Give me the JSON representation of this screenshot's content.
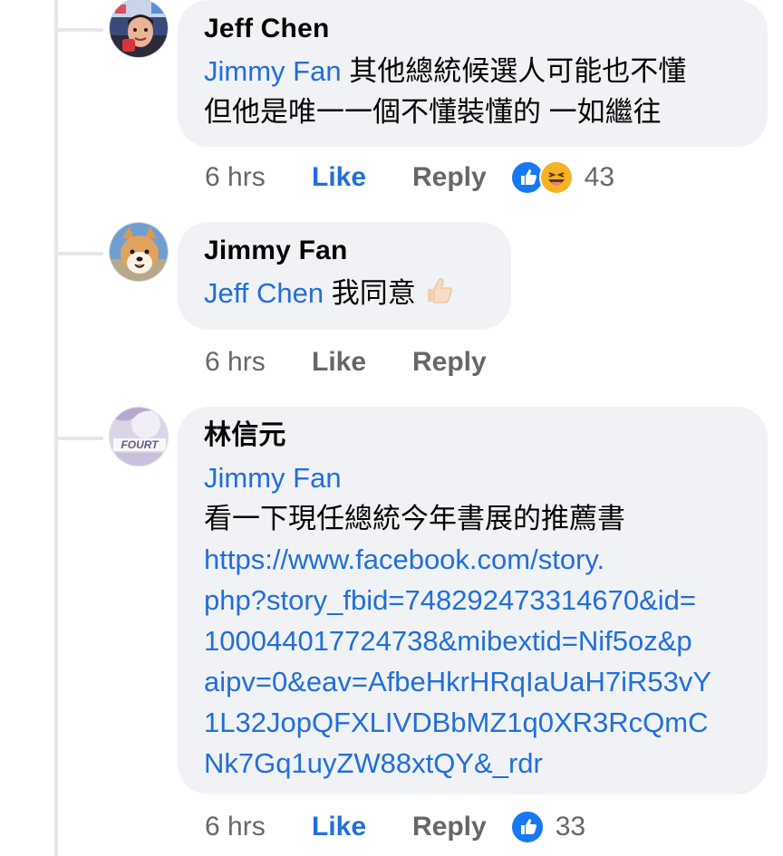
{
  "comments": [
    {
      "author": "Jeff Chen",
      "mention": "Jimmy  Fan",
      "lines": [
        "其他總統候選人可能也不懂",
        "但他是唯一一個不懂裝懂的 一如繼往"
      ],
      "time": "6 hrs",
      "like_label": "Like",
      "like_active": true,
      "reply_label": "Reply",
      "reactions": [
        "like-reaction-icon",
        "haha-reaction-icon"
      ],
      "reaction_count": "43",
      "avatar": "person-avatar"
    },
    {
      "author": "Jimmy  Fan",
      "mention": "Jeff Chen",
      "lines": [
        "我同意"
      ],
      "emoji": "thumbs-up-icon",
      "time": "6 hrs",
      "like_label": "Like",
      "like_active": false,
      "reply_label": "Reply",
      "avatar": "shiba-dog-avatar"
    },
    {
      "author": "林信元",
      "mention": "Jimmy  Fan",
      "lines": [
        "看一下現任總統今年書展的推薦書"
      ],
      "link_lines": [
        "https://www.facebook.com/story.",
        "php?story_fbid=748292473314670&id=",
        "100044017724738&mibextid=Nif5oz&p",
        "aipv=0&eav=AfbeHkrHRqIaUaH7iR53vY",
        "1L32JopQFXLIVDBbMZ1q0XR3RcQmC",
        "Nk7Gq1uyZW88xtQY&_rdr"
      ],
      "time": "6 hrs",
      "like_label": "Like",
      "like_active": true,
      "reply_label": "Reply",
      "reactions": [
        "like-reaction-icon"
      ],
      "reaction_count": "33",
      "avatar": "fourth-wing-book-avatar"
    }
  ],
  "colors": {
    "link": "#216fdb",
    "bubble": "#f0f2f5",
    "meta": "#65676b",
    "thread_line": "#e4e6eb"
  }
}
